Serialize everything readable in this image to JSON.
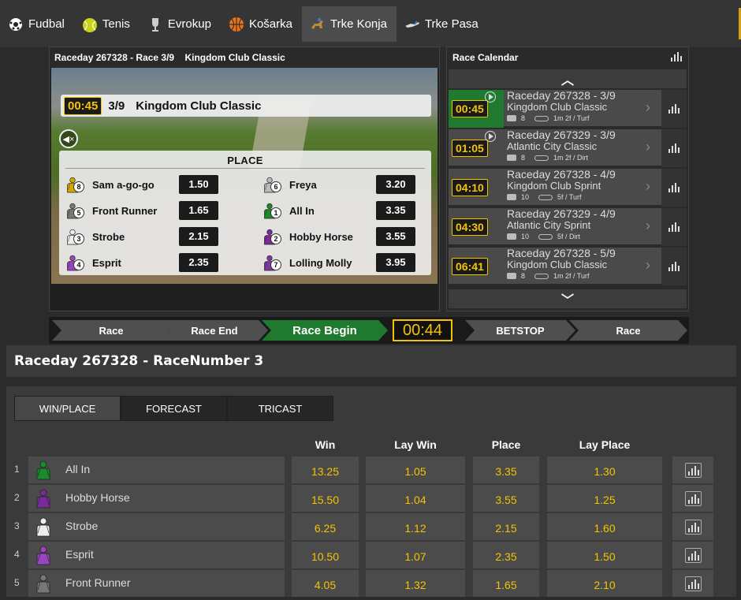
{
  "nav": {
    "items": [
      {
        "label": "Fudbal",
        "icon": "soccer-ball-icon"
      },
      {
        "label": "Tenis",
        "icon": "tennis-ball-icon"
      },
      {
        "label": "Evrokup",
        "icon": "trophy-icon"
      },
      {
        "label": "Košarka",
        "icon": "basketball-icon"
      },
      {
        "label": "Trke Konja",
        "icon": "horse-racing-icon",
        "active": true
      },
      {
        "label": "Trke Pasa",
        "icon": "greyhound-icon"
      }
    ]
  },
  "video": {
    "header": "Raceday 267328 - Race 3/9    Kingdom Club Classic",
    "time": "00:45",
    "race_no": "3/9",
    "race_name": "Kingdom Club Classic",
    "place_title": "PLACE",
    "place": [
      {
        "num": "8",
        "name": "Sam a-go-go",
        "odd": "1.50",
        "color": "#d4a800"
      },
      {
        "num": "5",
        "name": "Front Runner",
        "odd": "1.65",
        "color": "#777777"
      },
      {
        "num": "3",
        "name": "Strobe",
        "odd": "2.15",
        "color": "#eeeeee"
      },
      {
        "num": "4",
        "name": "Esprit",
        "odd": "2.35",
        "color": "#9b44c2"
      },
      {
        "num": "6",
        "name": "Freya",
        "odd": "3.20",
        "color": "#bbbbbb"
      },
      {
        "num": "1",
        "name": "All In",
        "odd": "3.35",
        "color": "#1a8a2a"
      },
      {
        "num": "2",
        "name": "Hobby Horse",
        "odd": "3.55",
        "color": "#7a2a9a"
      },
      {
        "num": "7",
        "name": "Lolling Molly",
        "odd": "3.95",
        "color": "#7a3aa0"
      }
    ]
  },
  "calendar": {
    "title": "Race Calendar",
    "items": [
      {
        "time": "00:45",
        "title": "Raceday 267328 - 3/9",
        "name": "Kingdom Club Classic",
        "runners": "8",
        "info": "1m 2f / Turf",
        "active": true,
        "play": true
      },
      {
        "time": "01:05",
        "title": "Raceday 267329 - 3/9",
        "name": "Atlantic City Classic",
        "runners": "8",
        "info": "1m 2f / Dirt",
        "play": true
      },
      {
        "time": "04:10",
        "title": "Raceday 267328 - 4/9",
        "name": "Kingdom Club Sprint",
        "runners": "10",
        "info": "5f / Turf"
      },
      {
        "time": "04:30",
        "title": "Raceday 267329 - 4/9",
        "name": "Atlantic City Sprint",
        "runners": "10",
        "info": "5f / Dirt"
      },
      {
        "time": "06:41",
        "title": "Raceday 267328 - 5/9",
        "name": "Kingdom Club Classic",
        "runners": "8",
        "info": "1m 2f / Turf"
      }
    ]
  },
  "progress": {
    "steps": [
      "Race",
      "Race End",
      "Race Begin",
      "BETSTOP",
      "Race"
    ],
    "countdown": "00:44"
  },
  "raceday": {
    "title": "Raceday 267328 - RaceNumber 3"
  },
  "market": {
    "tabs": [
      "WIN/PLACE",
      "FORECAST",
      "TRICAST"
    ],
    "active": 0
  },
  "table": {
    "headers": [
      "Win",
      "Lay Win",
      "Place",
      "Lay Place"
    ],
    "rows": [
      {
        "idx": "1",
        "name": "All In",
        "win": "13.25",
        "lay_win": "1.05",
        "place": "3.35",
        "lay_place": "1.30",
        "color": "#1a8a2a"
      },
      {
        "idx": "2",
        "name": "Hobby Horse",
        "win": "15.50",
        "lay_win": "1.04",
        "place": "3.55",
        "lay_place": "1.25",
        "color": "#7a2a9a"
      },
      {
        "idx": "3",
        "name": "Strobe",
        "win": "6.25",
        "lay_win": "1.12",
        "place": "2.15",
        "lay_place": "1.60",
        "color": "#eeeeee"
      },
      {
        "idx": "4",
        "name": "Esprit",
        "win": "10.50",
        "lay_win": "1.07",
        "place": "2.35",
        "lay_place": "1.50",
        "color": "#9b44c2"
      },
      {
        "idx": "5",
        "name": "Front Runner",
        "win": "4.05",
        "lay_win": "1.32",
        "place": "1.65",
        "lay_place": "2.10",
        "color": "#777777"
      }
    ]
  }
}
